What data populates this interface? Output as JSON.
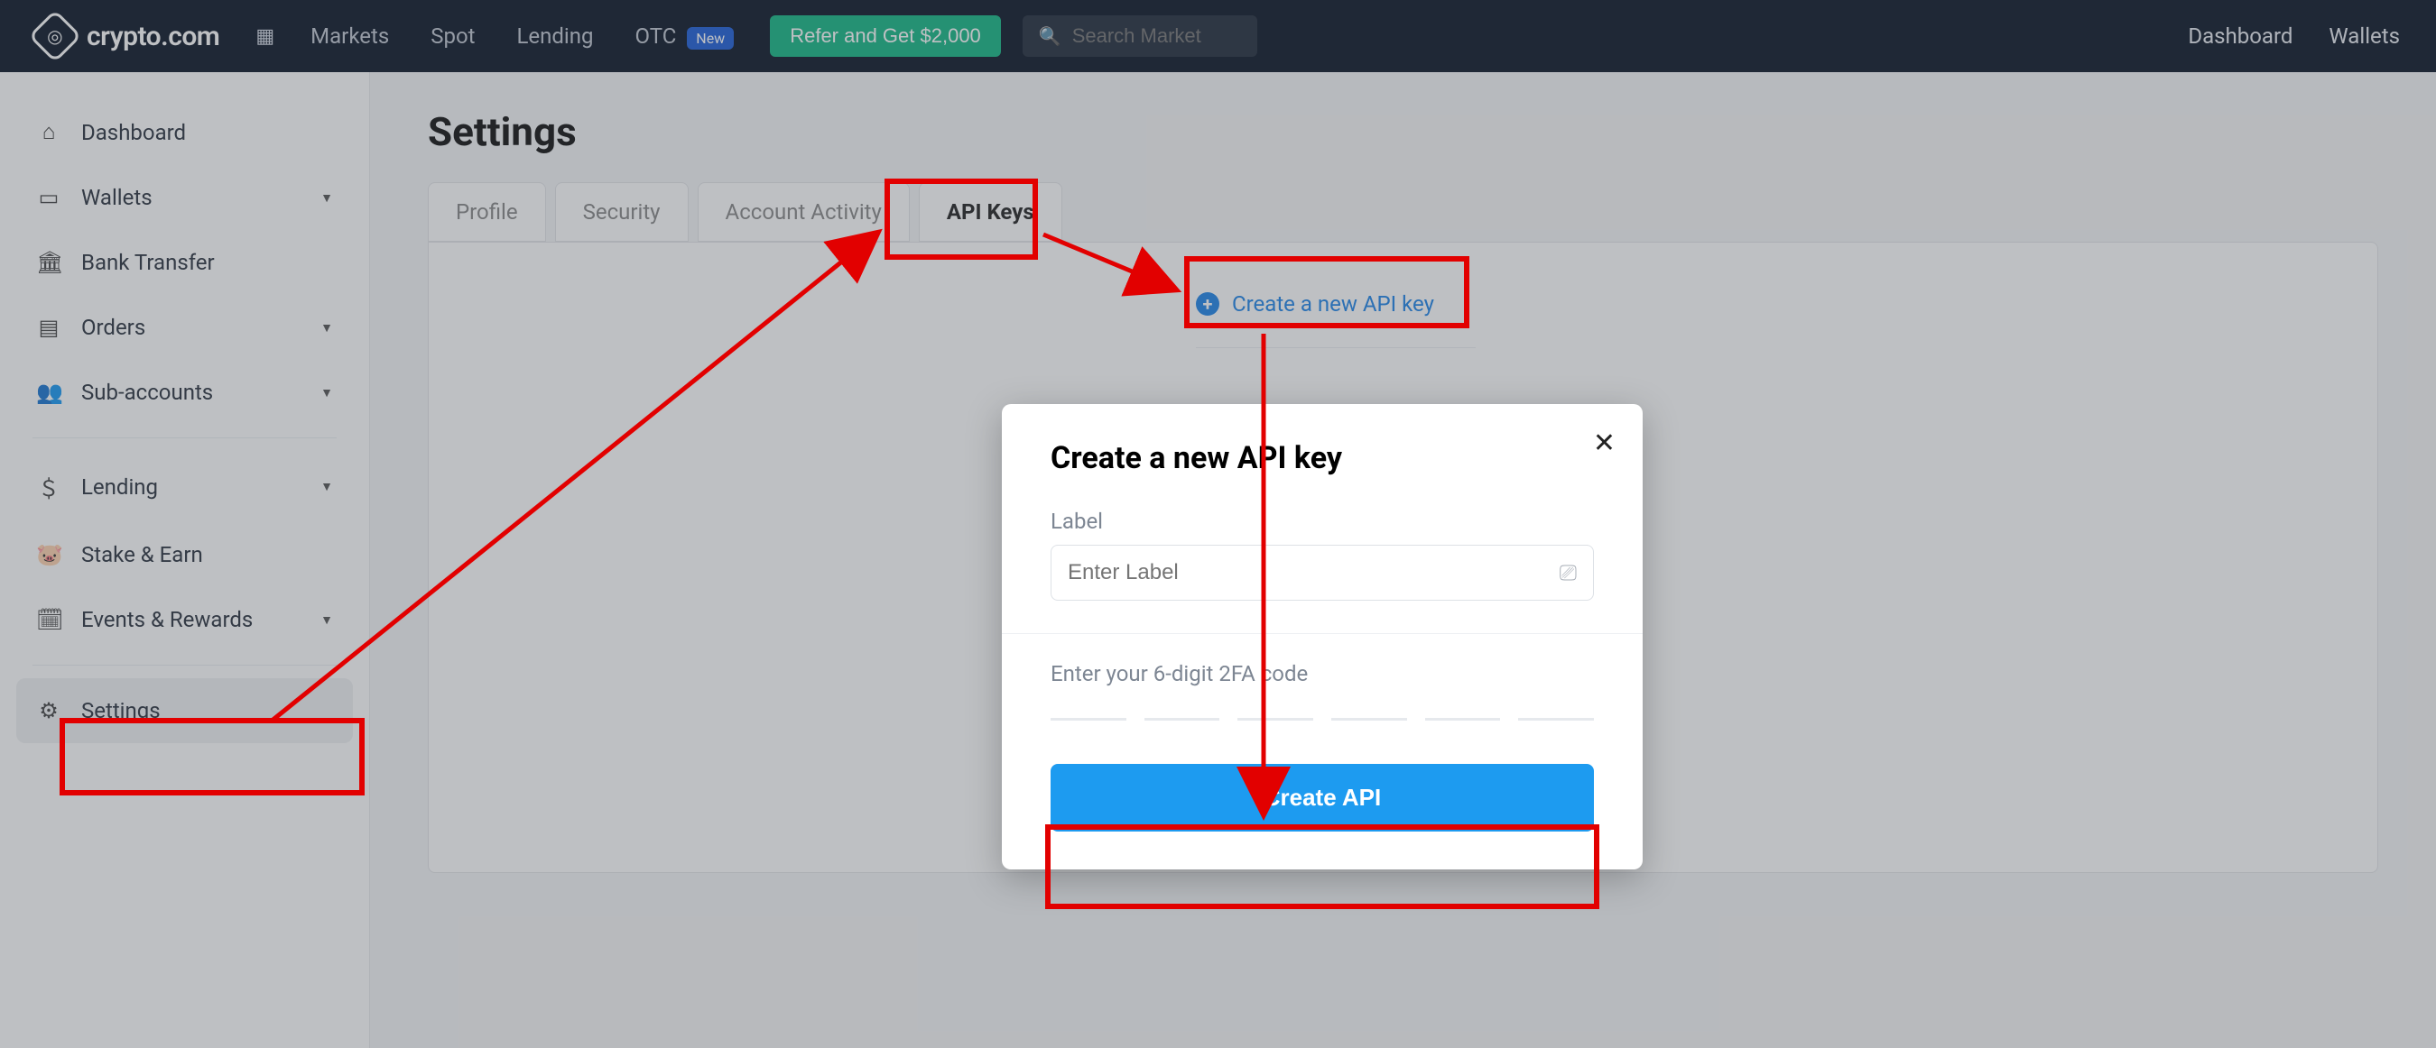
{
  "header": {
    "brand": "crypto.com",
    "nav": {
      "markets": "Markets",
      "spot": "Spot",
      "lending": "Lending",
      "otc": "OTC",
      "new_badge": "New"
    },
    "refer_label": "Refer and Get $2,000",
    "search_placeholder": "Search Market",
    "right": {
      "dashboard": "Dashboard",
      "wallets": "Wallets"
    }
  },
  "sidebar": {
    "dashboard": "Dashboard",
    "wallets": "Wallets",
    "bank_transfer": "Bank Transfer",
    "orders": "Orders",
    "sub_accounts": "Sub-accounts",
    "lending": "Lending",
    "stake_earn": "Stake & Earn",
    "events_rewards": "Events & Rewards",
    "settings": "Settings"
  },
  "main": {
    "title": "Settings",
    "tabs": {
      "profile": "Profile",
      "security": "Security",
      "account_activity": "Account Activity",
      "api_keys": "API Keys"
    },
    "create_key_link": "Create a new API key"
  },
  "modal": {
    "title": "Create a new API key",
    "label_label": "Label",
    "label_placeholder": "Enter Label",
    "tfa_label": "Enter your 6-digit 2FA code",
    "create_button": "Create API"
  }
}
